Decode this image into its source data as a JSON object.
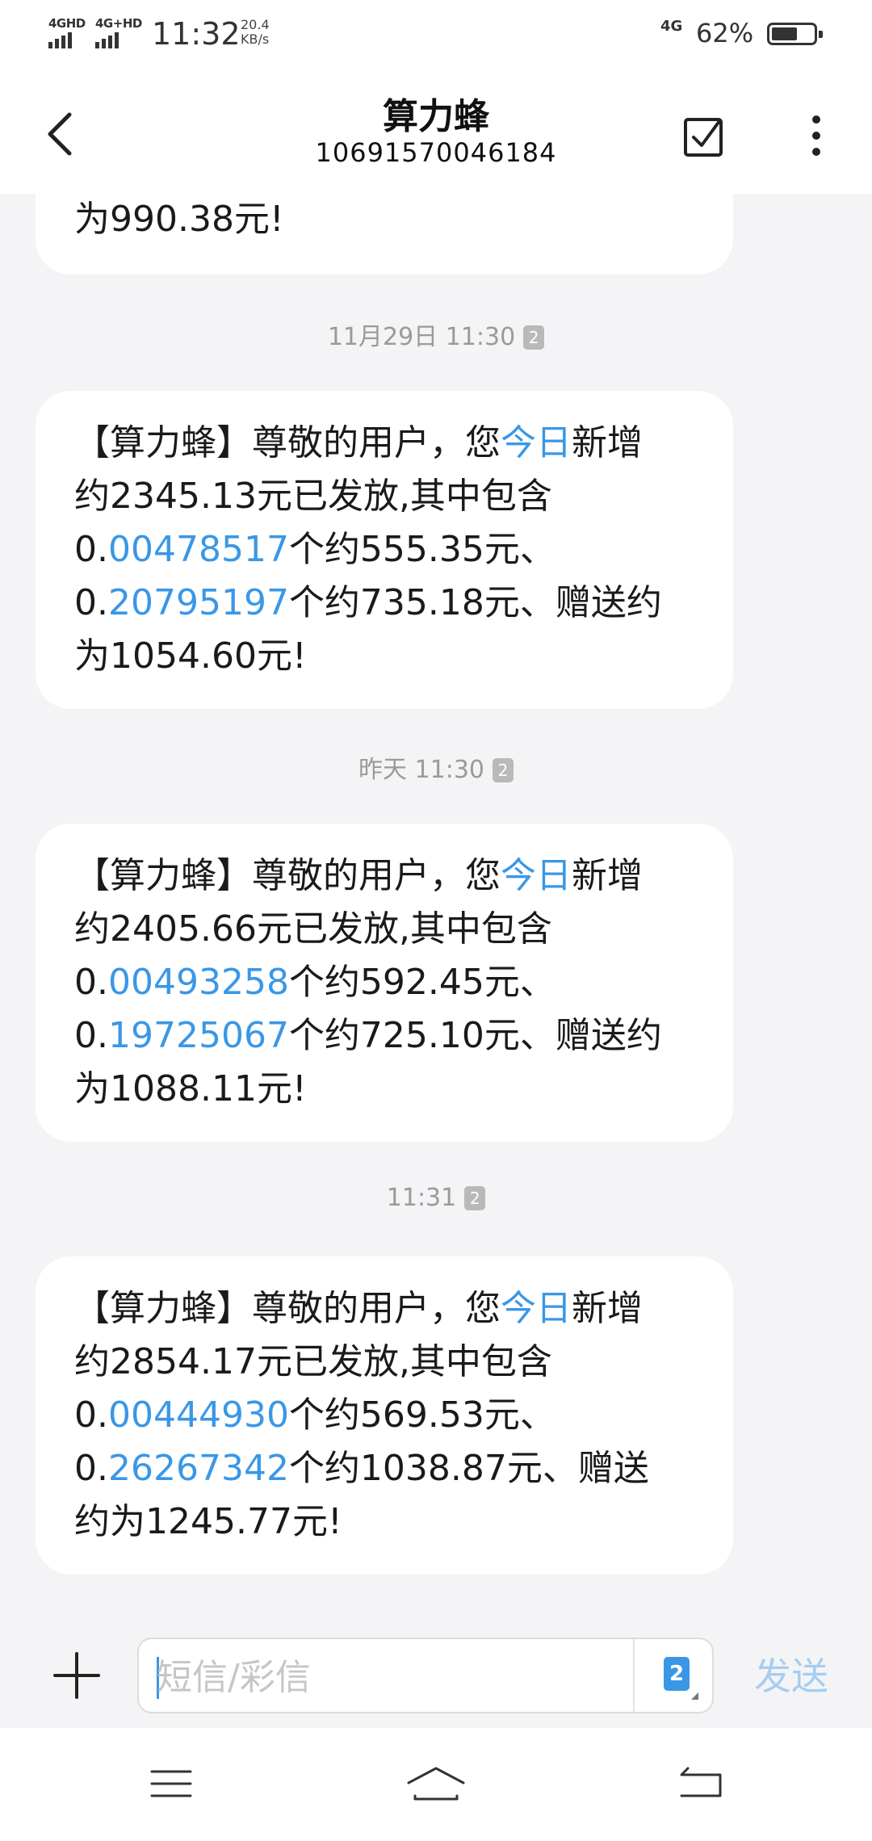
{
  "status_bar": {
    "network_1": "4GHD",
    "network_2": "4G+HD",
    "time": "11:32",
    "speed_value": "20.4",
    "speed_unit": "KB/s",
    "right_network": "4G",
    "battery_percent": "62%",
    "battery_level": 0.62
  },
  "header": {
    "title": "算力蜂",
    "subtitle": "10691570046184",
    "icons": [
      "back-arrow-icon",
      "select-checkbox-icon",
      "more-vertical-icon"
    ]
  },
  "messages": [
    {
      "parts": [
        {
          "t": "为990.38元!"
        }
      ]
    },
    {
      "timestamp": "11月29日 11:30",
      "sim": "2",
      "parts": [
        {
          "t": "【算力蜂】尊敬的用户，您"
        },
        {
          "t": "今日",
          "hl": true
        },
        {
          "t": "新增"
        },
        {
          "br": true
        },
        {
          "t": "约2345.13元已发放,其中包含"
        },
        {
          "br": true
        },
        {
          "t": "0."
        },
        {
          "t": "00478517",
          "hl": true
        },
        {
          "t": "个约555.35元、"
        },
        {
          "br": true
        },
        {
          "t": "0."
        },
        {
          "t": "20795197",
          "hl": true
        },
        {
          "t": "个约735.18元、赠送约"
        },
        {
          "br": true
        },
        {
          "t": "为1054.60元!"
        }
      ]
    },
    {
      "timestamp": "昨天 11:30",
      "sim": "2",
      "parts": [
        {
          "t": "【算力蜂】尊敬的用户，您"
        },
        {
          "t": "今日",
          "hl": true
        },
        {
          "t": "新增"
        },
        {
          "br": true
        },
        {
          "t": "约2405.66元已发放,其中包含"
        },
        {
          "br": true
        },
        {
          "t": "0."
        },
        {
          "t": "00493258",
          "hl": true
        },
        {
          "t": "个约592.45元、"
        },
        {
          "br": true
        },
        {
          "t": "0."
        },
        {
          "t": "19725067",
          "hl": true
        },
        {
          "t": "个约725.10元、赠送约"
        },
        {
          "br": true
        },
        {
          "t": "为1088.11元!"
        }
      ]
    },
    {
      "timestamp": "11:31",
      "sim": "2",
      "parts": [
        {
          "t": "【算力蜂】尊敬的用户，您"
        },
        {
          "t": "今日",
          "hl": true
        },
        {
          "t": "新增"
        },
        {
          "br": true
        },
        {
          "t": "约2854.17元已发放,其中包含"
        },
        {
          "br": true
        },
        {
          "t": "0."
        },
        {
          "t": "00444930",
          "hl": true
        },
        {
          "t": "个约569.53元、"
        },
        {
          "br": true
        },
        {
          "t": "0."
        },
        {
          "t": "26267342",
          "hl": true
        },
        {
          "t": "个约1038.87元、赠送"
        },
        {
          "br": true
        },
        {
          "t": "约为1245.77元!"
        }
      ]
    }
  ],
  "composer": {
    "placeholder": "短信/彩信",
    "sim_label": "2",
    "send_label": "发送"
  },
  "navbar": {
    "icons": [
      "menu-icon",
      "home-icon",
      "back-icon"
    ]
  },
  "colors": {
    "link": "#3a97e6",
    "send_disabled": "#a6cdf0",
    "background": "#f4f4f6"
  }
}
